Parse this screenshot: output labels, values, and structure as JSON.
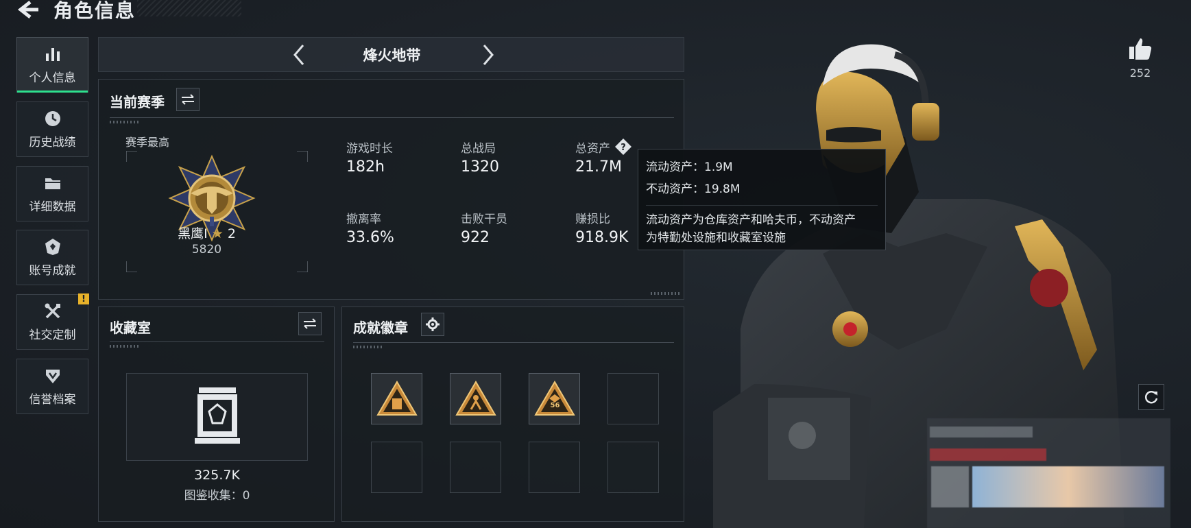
{
  "header": {
    "title": "角色信息"
  },
  "nav": {
    "items": [
      {
        "label": "个人信息",
        "icon": "bar-chart-icon",
        "active": true
      },
      {
        "label": "历史战绩",
        "icon": "history-icon"
      },
      {
        "label": "详细数据",
        "icon": "folder-icon"
      },
      {
        "label": "账号成就",
        "icon": "achievement-icon"
      },
      {
        "label": "社交定制",
        "icon": "tools-icon",
        "badge": "!"
      },
      {
        "label": "信誉档案",
        "icon": "shield-icon"
      }
    ]
  },
  "mode": {
    "title": "烽火地带"
  },
  "season": {
    "title": "当前赛季",
    "best_label": "赛季最高",
    "rank_name": "黑鹰I",
    "rank_stars": "2",
    "rank_score": "5820",
    "stats": [
      {
        "label": "游戏时长",
        "value": "182h"
      },
      {
        "label": "总战局",
        "value": "1320"
      },
      {
        "label": "总资产",
        "value": "21.7M"
      },
      {
        "label": "撤离率",
        "value": "33.6%"
      },
      {
        "label": "击败干员",
        "value": "922"
      },
      {
        "label": "赚损比",
        "value": "918.9K"
      }
    ]
  },
  "tooltip": {
    "liquid": "流动资产：1.9M",
    "fixed": "不动资产：19.8M",
    "desc1": "流动资产为仓库资产和哈夫币，不动资产",
    "desc2": "为特勤处设施和收藏室设施"
  },
  "collection": {
    "title": "收藏室",
    "value": "325.7K",
    "subtitle": "图鉴收集：0"
  },
  "badges": {
    "title": "成就徽章",
    "slots": [
      {
        "filled": true,
        "icon": "badge-vault-icon"
      },
      {
        "filled": true,
        "icon": "badge-runner-icon"
      },
      {
        "filled": true,
        "icon": "badge-dice-icon",
        "label": "56"
      },
      {
        "filled": false
      },
      {
        "filled": false
      },
      {
        "filled": false
      },
      {
        "filled": false
      },
      {
        "filled": false
      }
    ]
  },
  "likes": {
    "count": "252"
  },
  "colors": {
    "accent": "#2ee08e",
    "warning": "#e8b22a",
    "gold": "#c9a24a"
  }
}
